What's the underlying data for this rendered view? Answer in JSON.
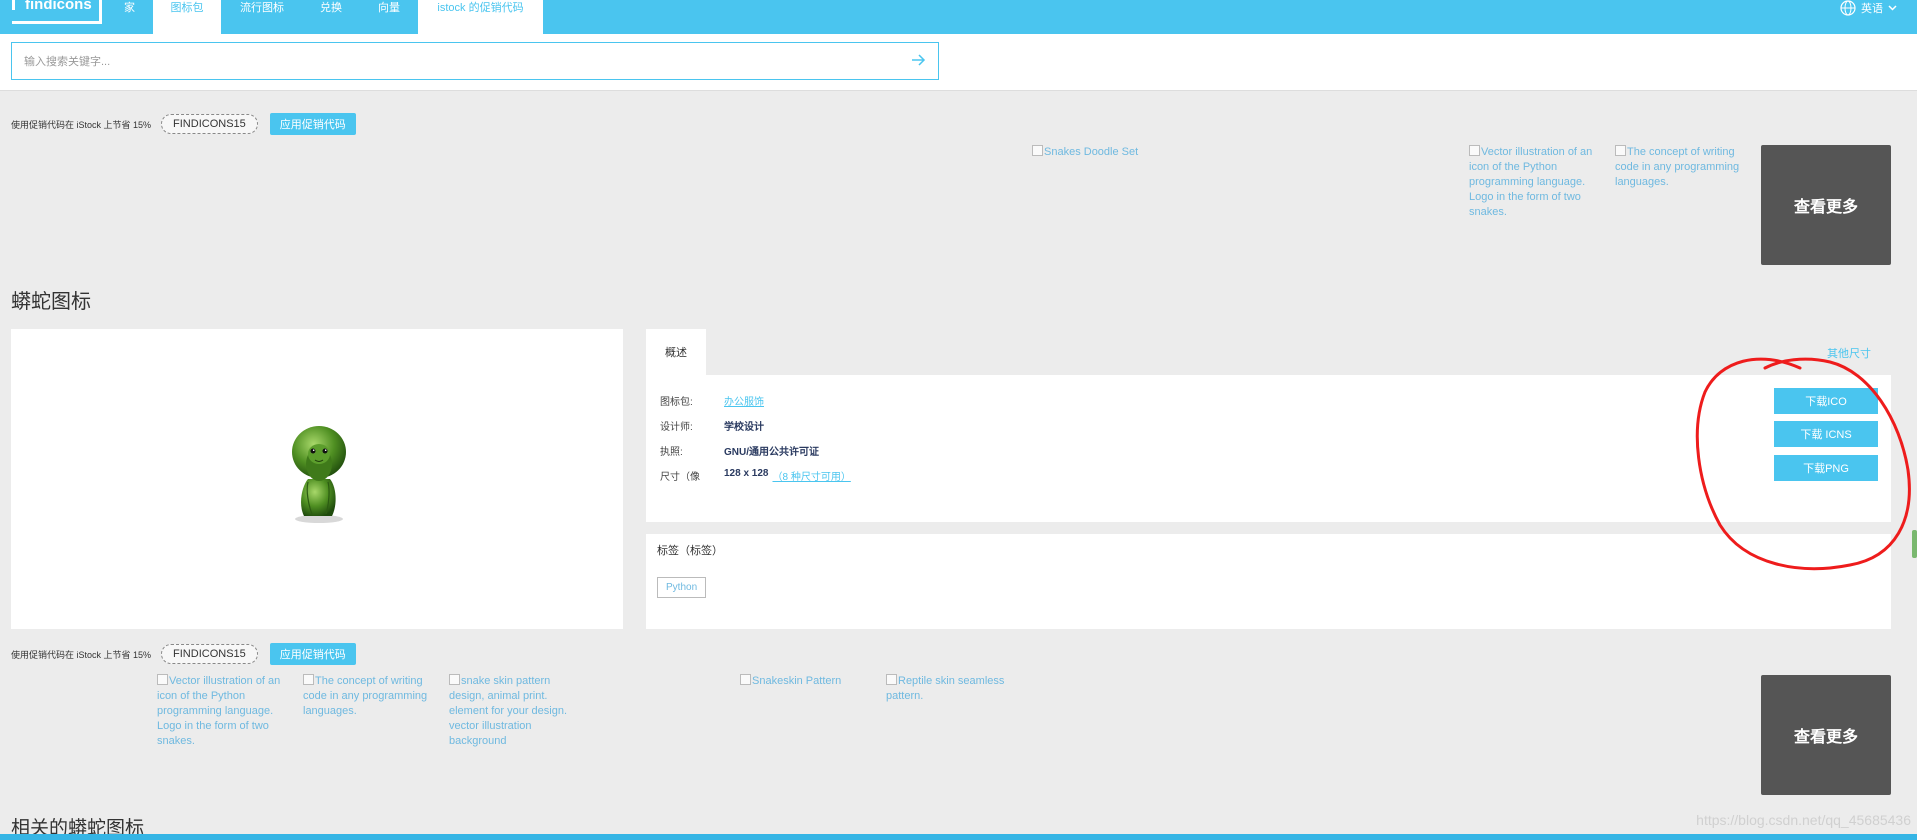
{
  "nav": {
    "logo_text": "findicons",
    "items": [
      {
        "label": "家",
        "active": false
      },
      {
        "label": "图标包",
        "active": true
      },
      {
        "label": "流行图标",
        "active": false
      },
      {
        "label": "兑换",
        "active": false
      },
      {
        "label": "向量",
        "active": false
      },
      {
        "label": "istock 的促销代码",
        "active": true
      }
    ],
    "language": "英语"
  },
  "search": {
    "placeholder": "输入搜索关键字..."
  },
  "promo": {
    "text": "使用促销代码在 iStock 上节省 15%",
    "code": "FINDICONS15",
    "apply_label": "应用促销代码"
  },
  "top_gallery": [
    "Snakes Doodle Set",
    "Vector illustration of an icon of the Python programming language. Logo in the form of two snakes.",
    "The concept of writing code in any programming languages."
  ],
  "see_more_label": "查看更多",
  "page_title": "蟒蛇图标",
  "details": {
    "tab_label": "概述",
    "other_sizes_label": "其他尺寸",
    "rows": [
      {
        "key": "图标包:",
        "value": "办公服饰",
        "link": true
      },
      {
        "key": "设计师:",
        "value": "学校设计",
        "link": false
      },
      {
        "key": "执照:",
        "value": "GNU/通用公共许可证",
        "link": false
      },
      {
        "key": "尺寸（像",
        "value": "128 x 128",
        "sub": "（8 种尺寸可用）",
        "link": false
      }
    ],
    "download_buttons": [
      "下载ICO",
      "下载 ICNS",
      "下载PNG"
    ]
  },
  "tags": {
    "title": "标签（标签）",
    "items": [
      "Python"
    ]
  },
  "bottom_gallery": [
    "Vector illustration of an icon of the Python programming language. Logo in the form of two snakes.",
    "The concept of writing code in any programming languages.",
    "snake skin pattern design, animal print. element for your design. vector illustration background",
    "Snakeskin Pattern",
    "Reptile skin seamless pattern."
  ],
  "related_title": "相关的蟒蛇图标",
  "watermark": "https://blog.csdn.net/qq_45685436",
  "colors": {
    "accent": "#4ac5ef",
    "annotation": "#ee1c1c",
    "see_more_bg": "#555555"
  }
}
